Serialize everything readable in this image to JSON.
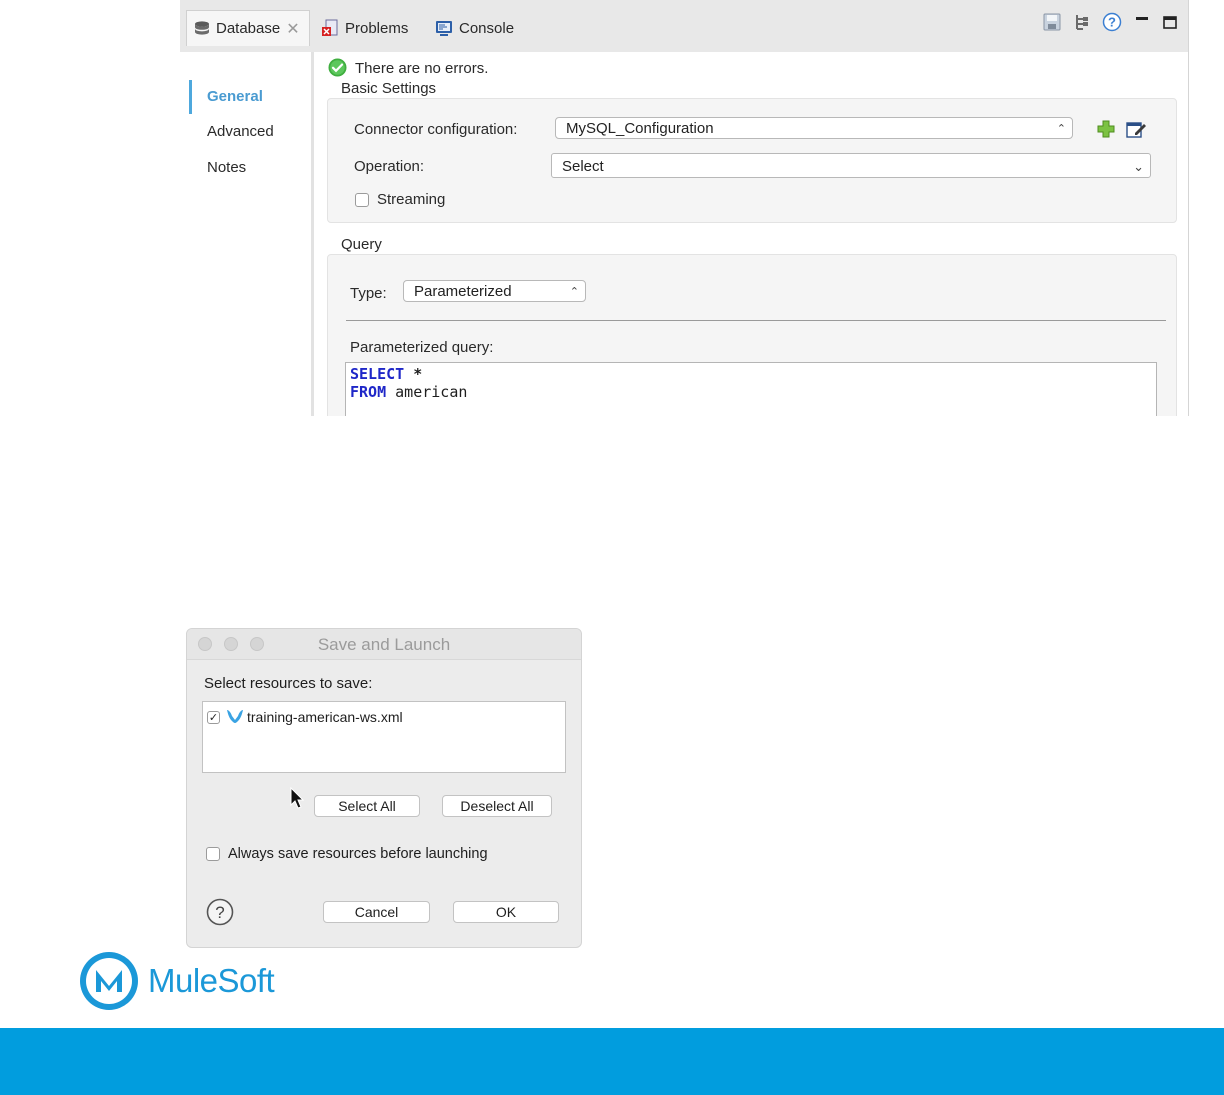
{
  "editor": {
    "tabs": [
      {
        "label": "Database",
        "active": true,
        "closable": true,
        "icon": "database-icon"
      },
      {
        "label": "Problems",
        "active": false,
        "icon": "problems-icon"
      },
      {
        "label": "Console",
        "active": false,
        "icon": "console-icon"
      }
    ],
    "toolbar_icons": [
      "save-icon",
      "tree-icon",
      "help-icon",
      "minimize-icon",
      "maximize-icon"
    ],
    "sidenav": {
      "items": [
        {
          "label": "General",
          "active": true
        },
        {
          "label": "Advanced",
          "active": false
        },
        {
          "label": "Notes",
          "active": false
        }
      ]
    },
    "status_message": "There are no errors.",
    "basic_settings": {
      "title": "Basic Settings",
      "connector_label": "Connector configuration:",
      "connector_value": "MySQL_Configuration",
      "operation_label": "Operation:",
      "operation_value": "Select",
      "streaming_label": "Streaming",
      "streaming_checked": false
    },
    "query": {
      "title": "Query",
      "type_label": "Type:",
      "type_value": "Parameterized",
      "param_label": "Parameterized query:",
      "code_line1_kw": "SELECT",
      "code_line1_rest": " *",
      "code_line2_kw": "FROM",
      "code_line2_rest": " american"
    }
  },
  "dialog": {
    "title": "Save and Launch",
    "select_label": "Select resources to save:",
    "resources": [
      {
        "name": "training-american-ws.xml",
        "checked": true,
        "icon": "mule-file-icon"
      }
    ],
    "select_all": "Select All",
    "deselect_all": "Deselect All",
    "always_save_label": "Always save resources before launching",
    "always_save_checked": false,
    "cancel": "Cancel",
    "ok": "OK"
  },
  "brand": {
    "name": "MuleSoft",
    "color": "#1b98d8",
    "band_color": "#019dde"
  }
}
